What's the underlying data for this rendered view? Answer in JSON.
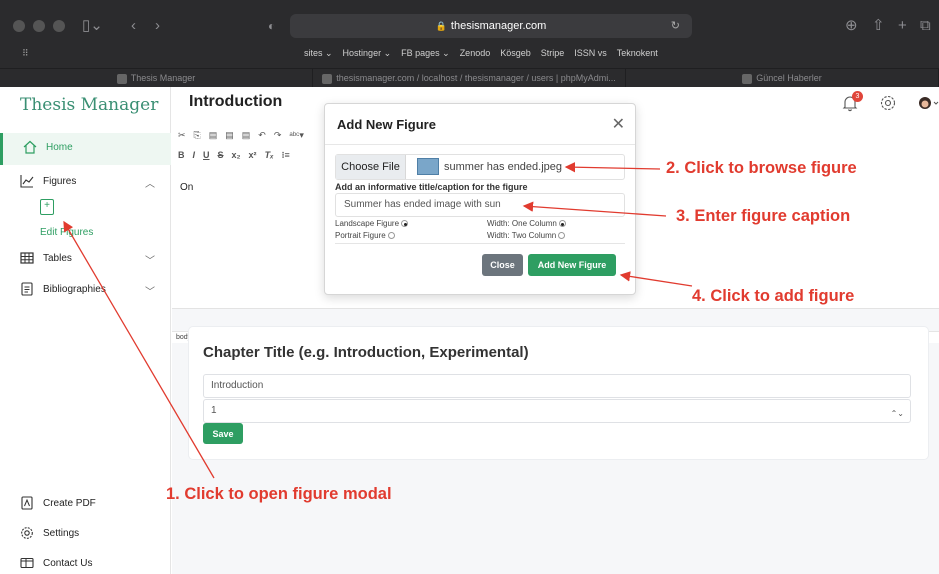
{
  "browser": {
    "url": "thesismanager.com",
    "bookmarks": [
      "sites ⌄",
      "Hostinger ⌄",
      "FB pages ⌄",
      "Zenodo",
      "Kösgeb",
      "Stripe",
      "ISSN vs",
      "Teknokent"
    ],
    "tabs": [
      "Thesis Manager",
      "thesismanager.com / localhost / thesismanager / users | phpMyAdmi...",
      "Güncel Haberler"
    ]
  },
  "sidebar": {
    "logo": "Thesis Manager",
    "home": "Home",
    "figures": "Figures",
    "edit_figures": "Edit Figures",
    "tables": "Tables",
    "bibliographies": "Bibliographies",
    "create_pdf": "Create PDF",
    "settings": "Settings",
    "contact": "Contact Us"
  },
  "header": {
    "page_title": "Introduction",
    "notification_count": "3"
  },
  "editor": {
    "content": "On",
    "statusbar": "body  p"
  },
  "chapter": {
    "title": "Chapter Title (e.g. Introduction, Experimental)",
    "title_value": "Introduction",
    "number_value": "1",
    "save_label": "Save"
  },
  "modal": {
    "title": "Add New Figure",
    "choose_file": "Choose File",
    "file_name": "summer has ended.jpeg",
    "caption_label": "Add an informative title/caption for the figure",
    "caption_value": "Summer has ended image with sun",
    "landscape": "Landscape Figure",
    "portrait": "Portrait Figure",
    "width_one": "Width: One Column",
    "width_two": "Width: Two Column",
    "close_label": "Close",
    "add_label": "Add New Figure"
  },
  "annotations": {
    "step1": "1. Click to open figure modal",
    "step2": "2. Click to browse figure",
    "step3": "3. Enter figure caption",
    "step4": "4. Click to add figure"
  },
  "colors": {
    "accent": "#2e9e62",
    "annotation": "#e13b2f"
  }
}
